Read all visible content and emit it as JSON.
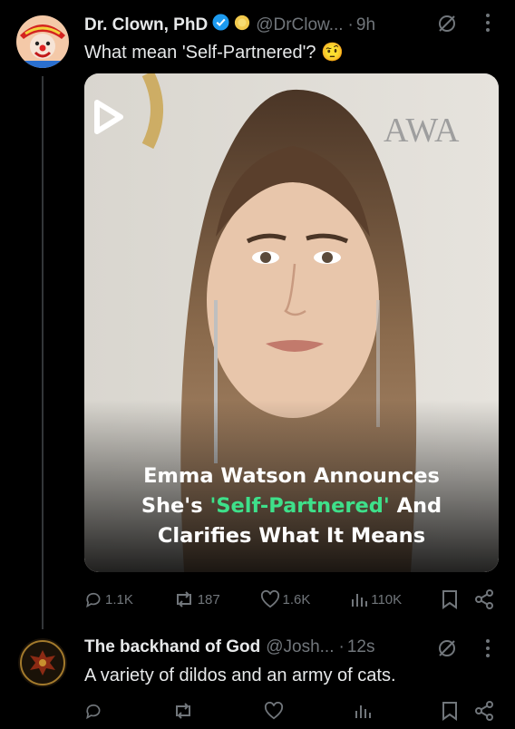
{
  "tweet1": {
    "name": "Dr. Clown, PhD",
    "handle": "@DrClow...",
    "dot": "·",
    "time": "9h",
    "text": "What mean 'Self-Partnered'? 🤨",
    "media": {
      "headline_line1": "Emma Watson Announces",
      "headline_line2_pre": "She's ",
      "headline_line2_hl": "'Self-Partnered'",
      "headline_line2_post": " And",
      "headline_line3": "Clarifies What It Means",
      "sign_text": "AWA"
    },
    "stats": {
      "replies": "1.1K",
      "reposts": "187",
      "likes": "1.6K",
      "views": "110K"
    }
  },
  "tweet2": {
    "name": "The backhand of God",
    "handle": "@Josh...",
    "dot": "·",
    "time": "12s",
    "text": "A variety of dildos and an army of cats."
  },
  "colors": {
    "background": "#000000",
    "text": "#e7e9ea",
    "muted": "#71767b",
    "verified": "#1d9bf0",
    "highlight": "#3ee08a"
  }
}
